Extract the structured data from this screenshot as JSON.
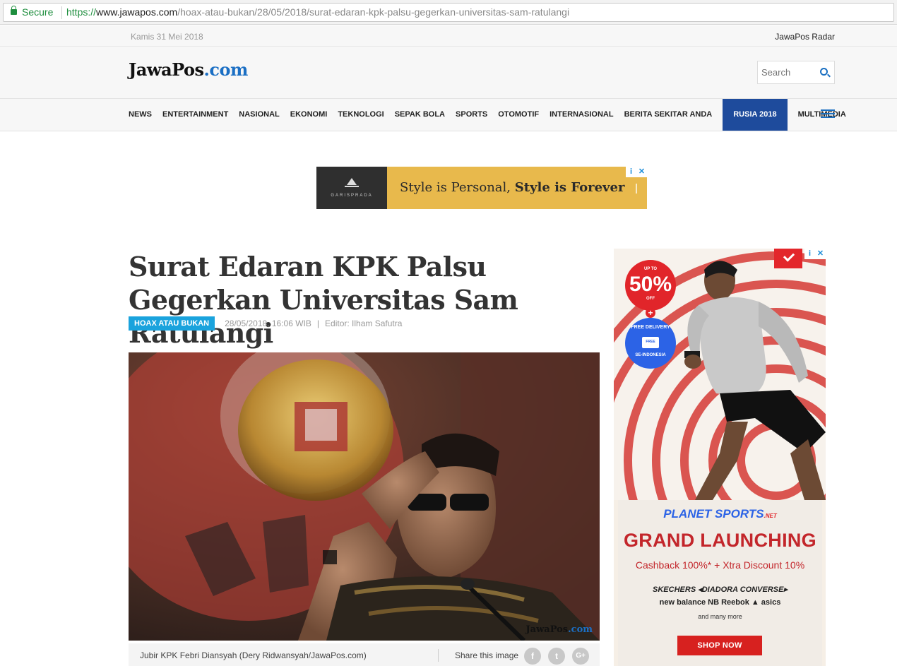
{
  "browser": {
    "secure_label": "Secure",
    "url_scheme": "https://",
    "url_host": "www.jawapos.com",
    "url_path": "/hoax-atau-bukan/28/05/2018/surat-edaran-kpk-palsu-gegerkan-universitas-sam-ratulangi"
  },
  "topbar": {
    "date": "Kamis 31 Mei 2018",
    "radar_link": "JawaPos Radar"
  },
  "header": {
    "logo_main": "JawaPos",
    "logo_suffix": ".com",
    "search_placeholder": "Search"
  },
  "nav": {
    "items": [
      "NEWS",
      "ENTERTAINMENT",
      "NASIONAL",
      "EKONOMI",
      "TEKNOLOGI",
      "SEPAK BOLA",
      "SPORTS",
      "OTOMOTIF",
      "INTERNASIONAL",
      "BERITA SEKITAR ANDA",
      "RUSIA 2018",
      "MULTIMEDIA"
    ],
    "active": "RUSIA 2018",
    "active_color": "#1e4b9c"
  },
  "banner_ad": {
    "brand": "GARISPRADA",
    "text_part1": "Style is Personal, ",
    "text_part2": "Style is Forever",
    "info_icon": "i",
    "close_icon": "✕"
  },
  "article": {
    "title": "Surat Edaran KPK Palsu Gegerkan Universitas Sam Ratulangi",
    "category": "HOAX ATAU BUKAN",
    "datetime": "28/05/2018, 16:06 WIB",
    "separator": "|",
    "editor": "Editor: Ilham Safutra",
    "photo_watermark_main": "JawaPos",
    "photo_watermark_suffix": ".com",
    "caption": "Jubir KPK Febri Diansyah (Dery Ridwansyah/JawaPos.com)",
    "share_label": "Share this image",
    "share_icons": [
      "f",
      "t",
      "G+"
    ]
  },
  "side_ad": {
    "up_to": "UP TO",
    "percent": "50%",
    "off": "OFF",
    "plus": "+",
    "free_delivery": "FREE DELIVERY",
    "truck_label": "FREE",
    "se_indonesia": "SE-INDONESIA",
    "logo_main": "PLANET SPORTS",
    "logo_suffix": ".NET",
    "headline": "GRAND LAUNCHING",
    "subline": "Cashback 100%* + Xtra Discount 10%",
    "brands_row1": "SKECHERS   ◂DIADORA   CONVERSE▸",
    "brands_row2": "new balance  NB  Reebok ▲  asics",
    "and_more": "and many more",
    "cta": "SHOP NOW",
    "info_icon": "i",
    "close_icon": "✕"
  },
  "colors": {
    "accent_blue": "#1a6fc1",
    "tag_blue": "#1aa3dd",
    "ad_red": "#c3262b",
    "banner_gold": "#e8b94c"
  }
}
